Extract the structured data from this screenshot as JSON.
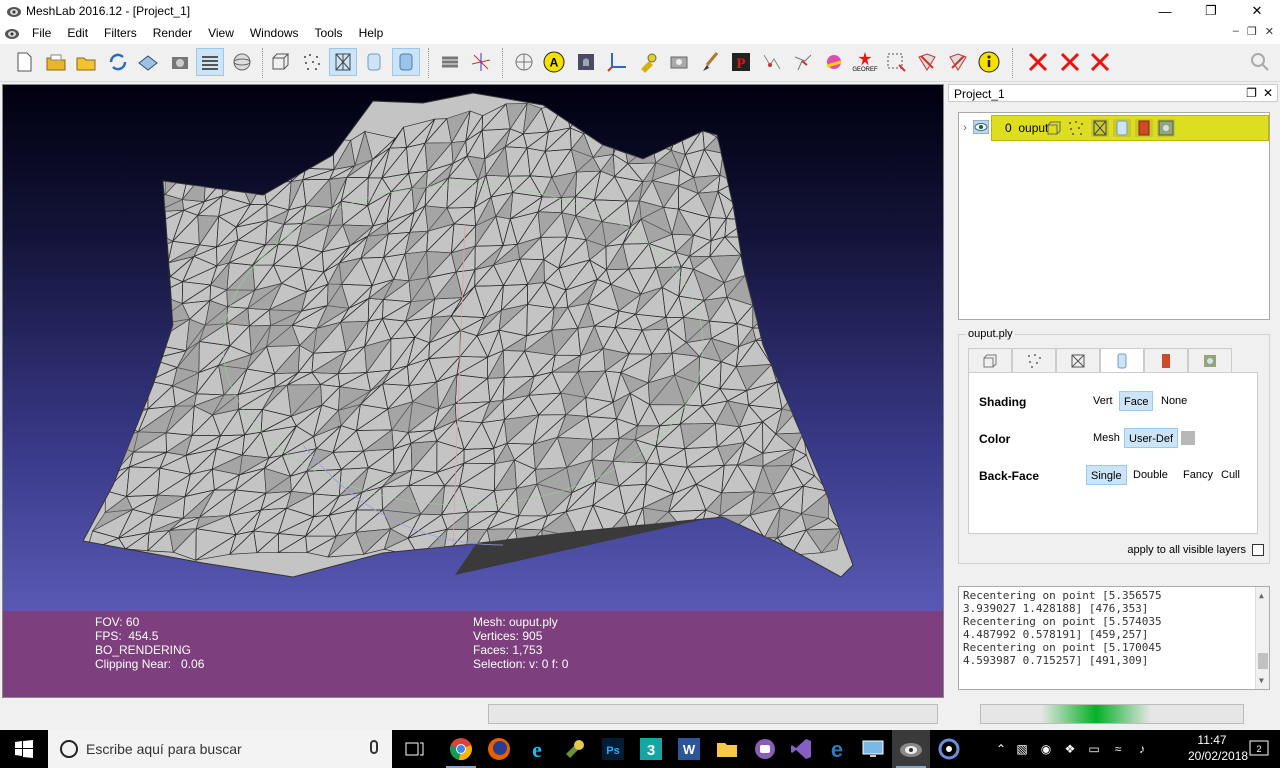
{
  "window": {
    "title": "MeshLab 2016.12 - [Project_1]"
  },
  "menu": [
    "File",
    "Edit",
    "Filters",
    "Render",
    "View",
    "Windows",
    "Tools",
    "Help"
  ],
  "toolbar": {
    "georef_label": "GEOREF",
    "annotation_letter": "A",
    "icons": [
      "new-project-icon",
      "open-project-icon",
      "open-mesh-icon",
      "reload-icon",
      "save-icon",
      "snapshot-icon",
      "layers-icon",
      "trackball-icon",
      "bbox-icon",
      "points-icon",
      "wireframe-icon",
      "flat-shading-icon",
      "smooth-shading-icon",
      "color-icon",
      "align-icon",
      "measure-icon",
      "annotation-icon",
      "texture-icon",
      "axis-icon",
      "paint-icon",
      "photo-icon",
      "brush-icon",
      "pick-points-icon",
      "select-vertices-icon",
      "select-faces-icon",
      "mesh-edit-icon",
      "color-paint-icon",
      "georef-icon",
      "select-region-icon",
      "delete-vertices-icon",
      "delete-faces-icon",
      "info-icon",
      "remove-1-icon",
      "remove-2-icon",
      "remove-3-icon",
      "search-icon"
    ]
  },
  "viewport": {
    "info_left": {
      "fov": "FOV: 60",
      "fps": "FPS:  454.5",
      "mode": "BO_RENDERING",
      "clipping": "Clipping Near:   0.06"
    },
    "info_right": {
      "mesh": "Mesh: ouput.ply",
      "vertices": "Vertices: 905",
      "faces": "Faces: 1,753",
      "selection": "Selection: v: 0 f: 0"
    }
  },
  "layers_panel": {
    "title": "Project_1",
    "layer": {
      "index_name": "0  ouput"
    }
  },
  "render_panel": {
    "file": "ouput.ply",
    "shading": {
      "label": "Shading",
      "options": [
        "Vert",
        "Face",
        "None"
      ],
      "selected": "Face"
    },
    "color": {
      "label": "Color",
      "options": [
        "Mesh",
        "User-Def"
      ],
      "selected": "User-Def"
    },
    "backface": {
      "label": "Back-Face",
      "options": [
        "Single",
        "Double",
        "Fancy",
        "Cull"
      ],
      "selected": "Single"
    },
    "apply_all": "apply to all visible layers"
  },
  "log": [
    "Recentering on point [5.356575",
    "3.939027 1.428188] [476,353]",
    "Recentering on point [5.574035",
    "4.487992 0.578191] [459,257]",
    "Recentering on point [5.170045",
    "4.593987 0.715257] [491,309]"
  ],
  "taskbar": {
    "search_placeholder": "Escribe aquí para buscar",
    "time": "11:47",
    "date": "20/02/2018"
  },
  "colors": {
    "info_bar": "#7e3f7e",
    "layer_highlight": "#dede20",
    "progress": "#06b025",
    "selected_option": "#cce4f7"
  }
}
